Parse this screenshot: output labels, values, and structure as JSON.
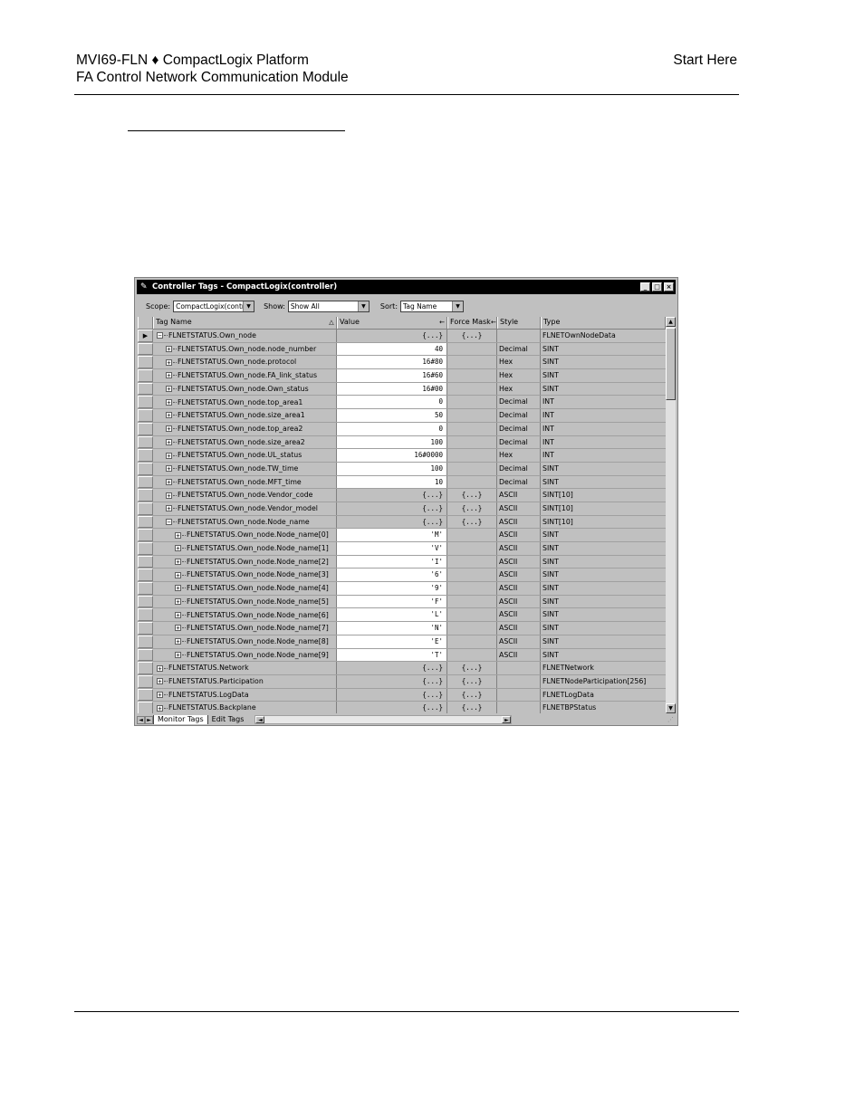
{
  "document": {
    "title_line1": "MVI69-FLN ♦ CompactLogix Platform",
    "title_line2": "FA Control Network Communication Module",
    "section": "Start Here"
  },
  "window": {
    "title": "Controller Tags - CompactLogix(controller)",
    "title_icon": "wrench-icon",
    "controls": [
      "_",
      "□",
      "×"
    ],
    "scope_label": "Scope:",
    "scope_value": "CompactLogix(contro",
    "show_label": "Show:",
    "show_value": "Show All",
    "sort_label": "Sort:",
    "sort_value": "Tag Name"
  },
  "columns": {
    "tag_name": "Tag Name",
    "tag_name_sort": "△",
    "value": "Value",
    "value_arrow": "←",
    "force_mask": "Force Mask",
    "force_arrow": "←",
    "style": "Style",
    "type": "Type"
  },
  "rows": [
    {
      "sel": "▶",
      "exp": "−",
      "name": "FLNETSTATUS.Own_node",
      "value": "{...}",
      "force": "{...}",
      "style": "",
      "type": "FLNETOwnNodeData",
      "level": 1,
      "white": false
    },
    {
      "sel": "",
      "exp": "+",
      "name": "FLNETSTATUS.Own_node.node_number",
      "value": "40",
      "force": "",
      "style": "Decimal",
      "type": "SINT",
      "level": 2,
      "white": true
    },
    {
      "sel": "",
      "exp": "+",
      "name": "FLNETSTATUS.Own_node.protocol",
      "value": "16#80",
      "force": "",
      "style": "Hex",
      "type": "SINT",
      "level": 2,
      "white": true
    },
    {
      "sel": "",
      "exp": "+",
      "name": "FLNETSTATUS.Own_node.FA_link_status",
      "value": "16#60",
      "force": "",
      "style": "Hex",
      "type": "SINT",
      "level": 2,
      "white": true
    },
    {
      "sel": "",
      "exp": "+",
      "name": "FLNETSTATUS.Own_node.Own_status",
      "value": "16#00",
      "force": "",
      "style": "Hex",
      "type": "SINT",
      "level": 2,
      "white": true
    },
    {
      "sel": "",
      "exp": "+",
      "name": "FLNETSTATUS.Own_node.top_area1",
      "value": "0",
      "force": "",
      "style": "Decimal",
      "type": "INT",
      "level": 2,
      "white": true
    },
    {
      "sel": "",
      "exp": "+",
      "name": "FLNETSTATUS.Own_node.size_area1",
      "value": "50",
      "force": "",
      "style": "Decimal",
      "type": "INT",
      "level": 2,
      "white": true
    },
    {
      "sel": "",
      "exp": "+",
      "name": "FLNETSTATUS.Own_node.top_area2",
      "value": "0",
      "force": "",
      "style": "Decimal",
      "type": "INT",
      "level": 2,
      "white": true
    },
    {
      "sel": "",
      "exp": "+",
      "name": "FLNETSTATUS.Own_node.size_area2",
      "value": "100",
      "force": "",
      "style": "Decimal",
      "type": "INT",
      "level": 2,
      "white": true
    },
    {
      "sel": "",
      "exp": "+",
      "name": "FLNETSTATUS.Own_node.UL_status",
      "value": "16#0000",
      "force": "",
      "style": "Hex",
      "type": "INT",
      "level": 2,
      "white": true
    },
    {
      "sel": "",
      "exp": "+",
      "name": "FLNETSTATUS.Own_node.TW_time",
      "value": "100",
      "force": "",
      "style": "Decimal",
      "type": "SINT",
      "level": 2,
      "white": true
    },
    {
      "sel": "",
      "exp": "+",
      "name": "FLNETSTATUS.Own_node.MFT_time",
      "value": "10",
      "force": "",
      "style": "Decimal",
      "type": "SINT",
      "level": 2,
      "white": true
    },
    {
      "sel": "",
      "exp": "+",
      "name": "FLNETSTATUS.Own_node.Vendor_code",
      "value": "{...}",
      "force": "{...}",
      "style": "ASCII",
      "type": "SINT[10]",
      "level": 2,
      "white": false
    },
    {
      "sel": "",
      "exp": "+",
      "name": "FLNETSTATUS.Own_node.Vendor_model",
      "value": "{...}",
      "force": "{...}",
      "style": "ASCII",
      "type": "SINT[10]",
      "level": 2,
      "white": false
    },
    {
      "sel": "",
      "exp": "−",
      "name": "FLNETSTATUS.Own_node.Node_name",
      "value": "{...}",
      "force": "{...}",
      "style": "ASCII",
      "type": "SINT[10]",
      "level": 2,
      "white": false
    },
    {
      "sel": "",
      "exp": "+",
      "name": "FLNETSTATUS.Own_node.Node_name[0]",
      "value": "'M'",
      "force": "",
      "style": "ASCII",
      "type": "SINT",
      "level": 3,
      "white": true
    },
    {
      "sel": "",
      "exp": "+",
      "name": "FLNETSTATUS.Own_node.Node_name[1]",
      "value": "'V'",
      "force": "",
      "style": "ASCII",
      "type": "SINT",
      "level": 3,
      "white": true
    },
    {
      "sel": "",
      "exp": "+",
      "name": "FLNETSTATUS.Own_node.Node_name[2]",
      "value": "'I'",
      "force": "",
      "style": "ASCII",
      "type": "SINT",
      "level": 3,
      "white": true
    },
    {
      "sel": "",
      "exp": "+",
      "name": "FLNETSTATUS.Own_node.Node_name[3]",
      "value": "'6'",
      "force": "",
      "style": "ASCII",
      "type": "SINT",
      "level": 3,
      "white": true
    },
    {
      "sel": "",
      "exp": "+",
      "name": "FLNETSTATUS.Own_node.Node_name[4]",
      "value": "'9'",
      "force": "",
      "style": "ASCII",
      "type": "SINT",
      "level": 3,
      "white": true
    },
    {
      "sel": "",
      "exp": "+",
      "name": "FLNETSTATUS.Own_node.Node_name[5]",
      "value": "'F'",
      "force": "",
      "style": "ASCII",
      "type": "SINT",
      "level": 3,
      "white": true
    },
    {
      "sel": "",
      "exp": "+",
      "name": "FLNETSTATUS.Own_node.Node_name[6]",
      "value": "'L'",
      "force": "",
      "style": "ASCII",
      "type": "SINT",
      "level": 3,
      "white": true
    },
    {
      "sel": "",
      "exp": "+",
      "name": "FLNETSTATUS.Own_node.Node_name[7]",
      "value": "'N'",
      "force": "",
      "style": "ASCII",
      "type": "SINT",
      "level": 3,
      "white": true
    },
    {
      "sel": "",
      "exp": "+",
      "name": "FLNETSTATUS.Own_node.Node_name[8]",
      "value": "'E'",
      "force": "",
      "style": "ASCII",
      "type": "SINT",
      "level": 3,
      "white": true
    },
    {
      "sel": "",
      "exp": "+",
      "name": "FLNETSTATUS.Own_node.Node_name[9]",
      "value": "'T'",
      "force": "",
      "style": "ASCII",
      "type": "SINT",
      "level": 3,
      "white": true
    },
    {
      "sel": "",
      "exp": "+",
      "name": "FLNETSTATUS.Network",
      "value": "{...}",
      "force": "{...}",
      "style": "",
      "type": "FLNETNetwork",
      "level": 1,
      "white": false
    },
    {
      "sel": "",
      "exp": "+",
      "name": "FLNETSTATUS.Participation",
      "value": "{...}",
      "force": "{...}",
      "style": "",
      "type": "FLNETNodeParticipation[256]",
      "level": 1,
      "white": false
    },
    {
      "sel": "",
      "exp": "+",
      "name": "FLNETSTATUS.LogData",
      "value": "{...}",
      "force": "{...}",
      "style": "",
      "type": "FLNETLogData",
      "level": 1,
      "white": false
    },
    {
      "sel": "",
      "exp": "+",
      "name": "FLNETSTATUS.Backplane",
      "value": "{...}",
      "force": "{...}",
      "style": "",
      "type": "FLNETBPStatus",
      "level": 1,
      "white": false
    }
  ],
  "tabs": {
    "monitor": "Monitor Tags",
    "edit": "Edit Tags"
  },
  "scroll": {
    "up": "▲",
    "down": "▼",
    "left": "◄",
    "right": "►"
  }
}
